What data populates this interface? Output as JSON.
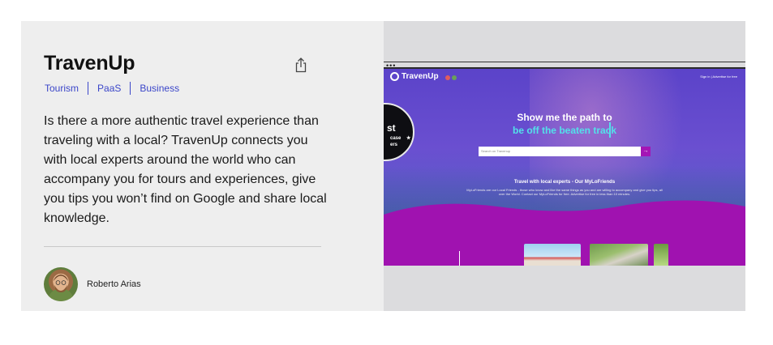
{
  "project": {
    "title": "TravenUp",
    "tags": [
      "Tourism",
      "PaaS",
      "Business"
    ],
    "description": "Is there a more authentic travel experience than traveling with a local? TravenUp connects you with local experts around the world who can accompany you for tours and experiences, give you tips you won’t find on Google and share local knowledge.",
    "author": "Roberto Arias"
  },
  "icons": {
    "share": "share-icon",
    "avatar": "avatar"
  },
  "preview": {
    "browser_dots": "•••",
    "logo": "TravenUp",
    "nav": "Sign in | Advertise for free",
    "hero_line1": "Show me the path to",
    "hero_line2": "be off the beaten track",
    "search_placeholder": "Search on Travenup",
    "search_button": "→",
    "section_title": "Travel with local experts - Our MyLoFriends",
    "section_text": "MyLoFriends are our Local Friends - those who know and like the same things as you and are willing to accompany and give you tips, all over the World. Contact our MyLoFriends for free. Advertise for free in less than 10 minutes.",
    "badge_l1": "st",
    "badge_l2": "case",
    "badge_l3": "ers"
  },
  "colors": {
    "accent_link": "#3b46c9",
    "site_purple": "#5b43c9",
    "site_magenta": "#a415b5",
    "hero_cyan": "#53e0ea"
  }
}
